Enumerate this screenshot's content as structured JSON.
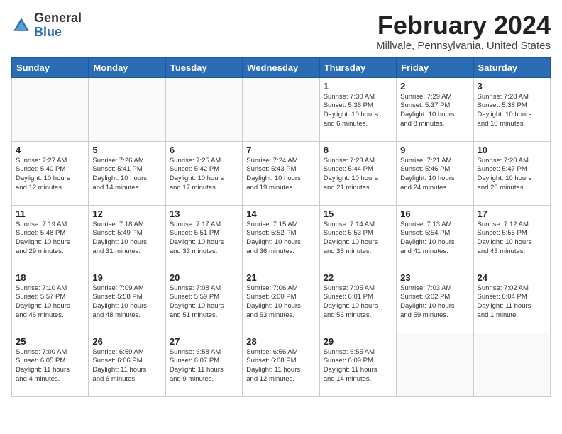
{
  "header": {
    "logo_general": "General",
    "logo_blue": "Blue",
    "month_title": "February 2024",
    "location": "Millvale, Pennsylvania, United States"
  },
  "weekdays": [
    "Sunday",
    "Monday",
    "Tuesday",
    "Wednesday",
    "Thursday",
    "Friday",
    "Saturday"
  ],
  "weeks": [
    [
      {
        "day": "",
        "info": ""
      },
      {
        "day": "",
        "info": ""
      },
      {
        "day": "",
        "info": ""
      },
      {
        "day": "",
        "info": ""
      },
      {
        "day": "1",
        "info": "Sunrise: 7:30 AM\nSunset: 5:36 PM\nDaylight: 10 hours\nand 6 minutes."
      },
      {
        "day": "2",
        "info": "Sunrise: 7:29 AM\nSunset: 5:37 PM\nDaylight: 10 hours\nand 8 minutes."
      },
      {
        "day": "3",
        "info": "Sunrise: 7:28 AM\nSunset: 5:38 PM\nDaylight: 10 hours\nand 10 minutes."
      }
    ],
    [
      {
        "day": "4",
        "info": "Sunrise: 7:27 AM\nSunset: 5:40 PM\nDaylight: 10 hours\nand 12 minutes."
      },
      {
        "day": "5",
        "info": "Sunrise: 7:26 AM\nSunset: 5:41 PM\nDaylight: 10 hours\nand 14 minutes."
      },
      {
        "day": "6",
        "info": "Sunrise: 7:25 AM\nSunset: 5:42 PM\nDaylight: 10 hours\nand 17 minutes."
      },
      {
        "day": "7",
        "info": "Sunrise: 7:24 AM\nSunset: 5:43 PM\nDaylight: 10 hours\nand 19 minutes."
      },
      {
        "day": "8",
        "info": "Sunrise: 7:23 AM\nSunset: 5:44 PM\nDaylight: 10 hours\nand 21 minutes."
      },
      {
        "day": "9",
        "info": "Sunrise: 7:21 AM\nSunset: 5:46 PM\nDaylight: 10 hours\nand 24 minutes."
      },
      {
        "day": "10",
        "info": "Sunrise: 7:20 AM\nSunset: 5:47 PM\nDaylight: 10 hours\nand 26 minutes."
      }
    ],
    [
      {
        "day": "11",
        "info": "Sunrise: 7:19 AM\nSunset: 5:48 PM\nDaylight: 10 hours\nand 29 minutes."
      },
      {
        "day": "12",
        "info": "Sunrise: 7:18 AM\nSunset: 5:49 PM\nDaylight: 10 hours\nand 31 minutes."
      },
      {
        "day": "13",
        "info": "Sunrise: 7:17 AM\nSunset: 5:51 PM\nDaylight: 10 hours\nand 33 minutes."
      },
      {
        "day": "14",
        "info": "Sunrise: 7:15 AM\nSunset: 5:52 PM\nDaylight: 10 hours\nand 36 minutes."
      },
      {
        "day": "15",
        "info": "Sunrise: 7:14 AM\nSunset: 5:53 PM\nDaylight: 10 hours\nand 38 minutes."
      },
      {
        "day": "16",
        "info": "Sunrise: 7:13 AM\nSunset: 5:54 PM\nDaylight: 10 hours\nand 41 minutes."
      },
      {
        "day": "17",
        "info": "Sunrise: 7:12 AM\nSunset: 5:55 PM\nDaylight: 10 hours\nand 43 minutes."
      }
    ],
    [
      {
        "day": "18",
        "info": "Sunrise: 7:10 AM\nSunset: 5:57 PM\nDaylight: 10 hours\nand 46 minutes."
      },
      {
        "day": "19",
        "info": "Sunrise: 7:09 AM\nSunset: 5:58 PM\nDaylight: 10 hours\nand 48 minutes."
      },
      {
        "day": "20",
        "info": "Sunrise: 7:08 AM\nSunset: 5:59 PM\nDaylight: 10 hours\nand 51 minutes."
      },
      {
        "day": "21",
        "info": "Sunrise: 7:06 AM\nSunset: 6:00 PM\nDaylight: 10 hours\nand 53 minutes."
      },
      {
        "day": "22",
        "info": "Sunrise: 7:05 AM\nSunset: 6:01 PM\nDaylight: 10 hours\nand 56 minutes."
      },
      {
        "day": "23",
        "info": "Sunrise: 7:03 AM\nSunset: 6:02 PM\nDaylight: 10 hours\nand 59 minutes."
      },
      {
        "day": "24",
        "info": "Sunrise: 7:02 AM\nSunset: 6:04 PM\nDaylight: 11 hours\nand 1 minute."
      }
    ],
    [
      {
        "day": "25",
        "info": "Sunrise: 7:00 AM\nSunset: 6:05 PM\nDaylight: 11 hours\nand 4 minutes."
      },
      {
        "day": "26",
        "info": "Sunrise: 6:59 AM\nSunset: 6:06 PM\nDaylight: 11 hours\nand 6 minutes."
      },
      {
        "day": "27",
        "info": "Sunrise: 6:58 AM\nSunset: 6:07 PM\nDaylight: 11 hours\nand 9 minutes."
      },
      {
        "day": "28",
        "info": "Sunrise: 6:56 AM\nSunset: 6:08 PM\nDaylight: 11 hours\nand 12 minutes."
      },
      {
        "day": "29",
        "info": "Sunrise: 6:55 AM\nSunset: 6:09 PM\nDaylight: 11 hours\nand 14 minutes."
      },
      {
        "day": "",
        "info": ""
      },
      {
        "day": "",
        "info": ""
      }
    ]
  ]
}
